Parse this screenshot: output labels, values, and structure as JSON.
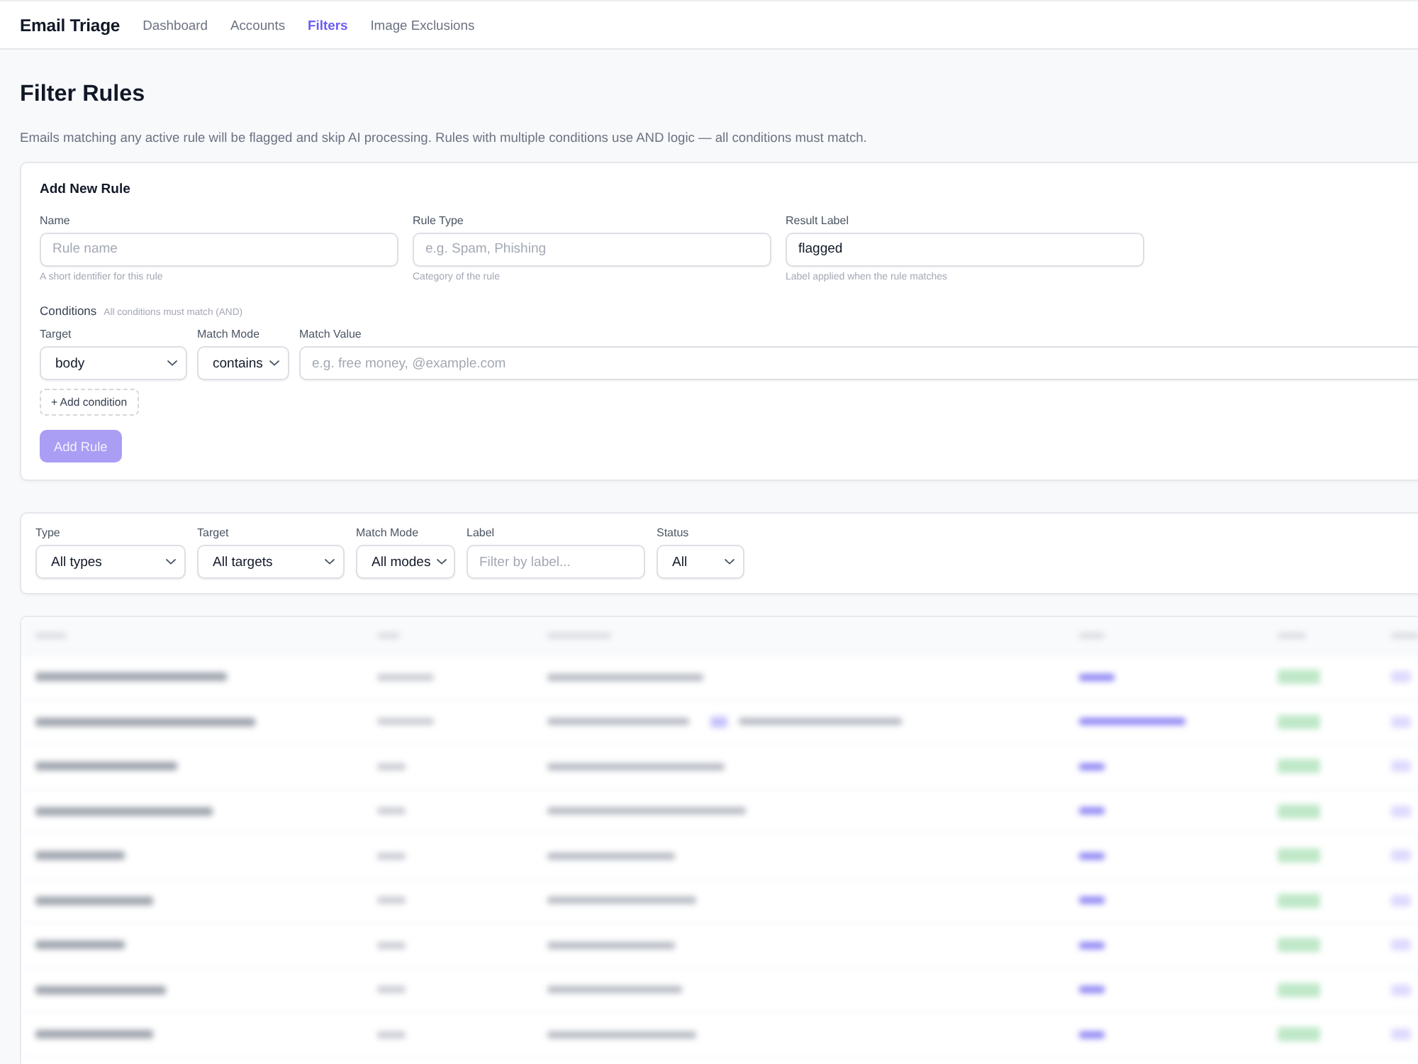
{
  "nav": {
    "brand": "Email Triage",
    "links": [
      {
        "label": "Dashboard",
        "selected": false
      },
      {
        "label": "Accounts",
        "selected": false
      },
      {
        "label": "Filters",
        "selected": true
      },
      {
        "label": "Image Exclusions",
        "selected": false
      }
    ]
  },
  "page": {
    "title": "Filter Rules",
    "description": "Emails matching any active rule will be flagged and skip AI processing. Rules with multiple conditions use AND logic — all conditions must match."
  },
  "add_rule_form": {
    "title": "Add New Rule",
    "fields": [
      {
        "label": "Name",
        "placeholder": "Rule name",
        "hint": "A short identifier for this rule"
      },
      {
        "label": "Rule Type",
        "placeholder": "e.g. Spam, Phishing",
        "hint": "Category of the rule"
      },
      {
        "label": "Result Label",
        "value": "flagged",
        "hint": "Label applied when the rule matches"
      }
    ],
    "conditions": {
      "title": "Conditions",
      "note": "All conditions must match (AND)",
      "column_labels": [
        "Target",
        "Match Mode",
        "Match Value"
      ],
      "rows": [
        {
          "target": "body",
          "match_mode": "contains",
          "value_placeholder": "e.g. free money, @example.com"
        }
      ],
      "add_button": "+ Add condition"
    },
    "submit": {
      "label": "Add Rule",
      "disabled": true
    }
  },
  "filters": [
    {
      "kind": "select",
      "label": "Type",
      "value": "All types"
    },
    {
      "kind": "select",
      "label": "Target",
      "value": "All targets"
    },
    {
      "kind": "select",
      "label": "Match Mode",
      "value": "All modes"
    },
    {
      "kind": "input",
      "label": "Label",
      "placeholder": "Filter by label..."
    },
    {
      "kind": "select",
      "label": "Status",
      "value": "All"
    }
  ]
}
